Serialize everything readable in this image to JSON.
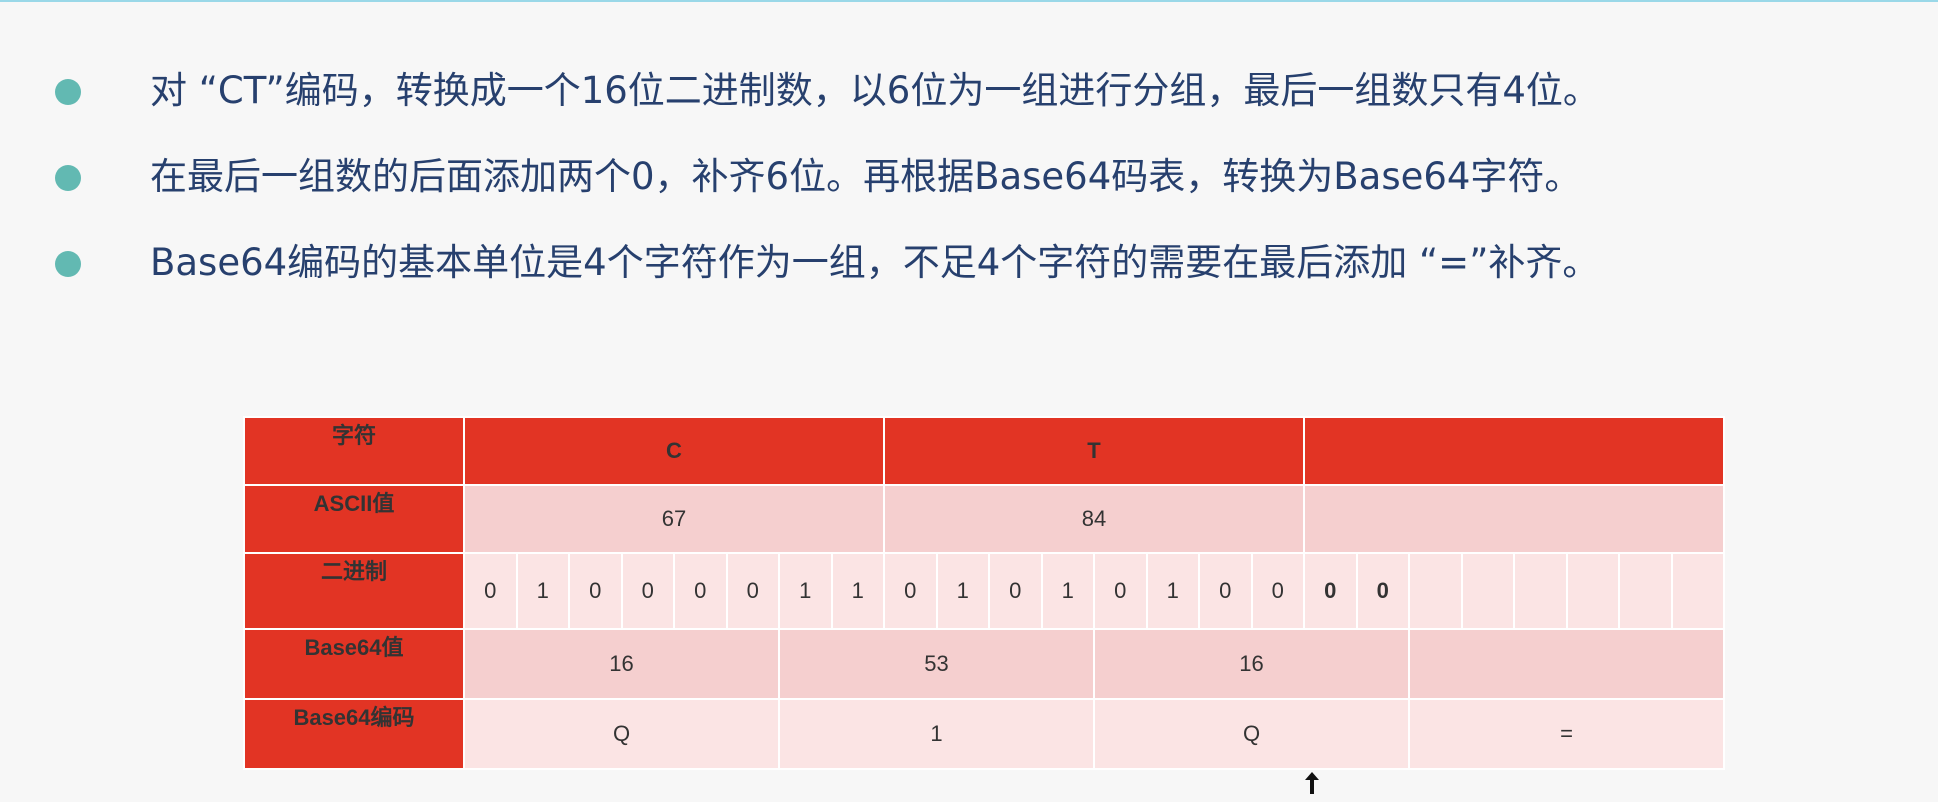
{
  "bullets": [
    "对 “CT”编码，转换成一个16位二进制数，以6位为一组进行分组，最后一组数只有4位。",
    "在最后一组数的后面添加两个0，补齐6位。再根据Base64码表，转换为Base64字符。",
    "Base64编码的基本单位是4个字符作为一组，不足4个字符的需要在最后添加 “=”补齐。"
  ],
  "table": {
    "labels": {
      "char": "字符",
      "ascii": "ASCII值",
      "binary": "二进制",
      "b64value": "Base64值",
      "b64code": "Base64编码"
    },
    "chars": [
      "C",
      "T",
      ""
    ],
    "ascii": [
      "67",
      "84",
      ""
    ],
    "bits": [
      "0",
      "1",
      "0",
      "0",
      "0",
      "0",
      "1",
      "1",
      "0",
      "1",
      "0",
      "1",
      "0",
      "1",
      "0",
      "0",
      "0",
      "0",
      "",
      "",
      "",
      "",
      "",
      ""
    ],
    "b64values": [
      "16",
      "53",
      "16",
      ""
    ],
    "b64codes": [
      "Q",
      "1",
      "Q",
      "="
    ]
  },
  "colors": {
    "header_red": "#e23424",
    "row_dark": "#f5cfcf",
    "row_light": "#fbe4e4",
    "bullet_dot": "#62b9b2",
    "text_blue": "#27406e"
  }
}
